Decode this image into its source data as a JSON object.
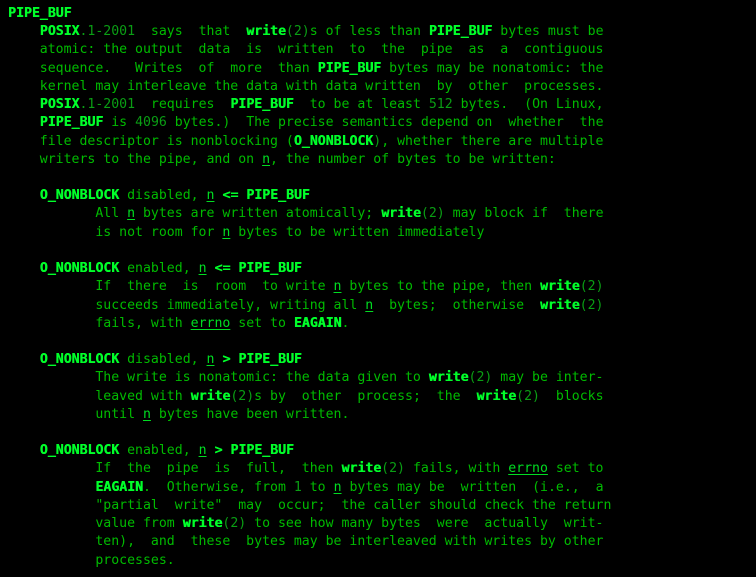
{
  "terminal": {
    "app": "man-page-viewer",
    "foreground_color": "#00bb00",
    "bold_color": "#00ff2a",
    "background_color": "#000000",
    "section_heading": "PIPE_BUF",
    "lines": [
      "PIPE_BUF",
      "    POSIX.1-2001  says  that  write(2)s of less than PIPE_BUF bytes must be",
      "    atomic: the output  data  is  written  to  the  pipe  as  a  contiguous",
      "    sequence.   Writes  of  more  than PIPE_BUF bytes may be nonatomic: the",
      "    kernel may interleave the data with data written  by  other  processes.",
      "    POSIX.1-2001  requires  PIPE_BUF  to be at least 512 bytes.  (On Linux,",
      "    PIPE_BUF is 4096 bytes.)  The precise semantics depend on  whether  the",
      "    file descriptor is nonblocking (O_NONBLOCK), whether there are multiple",
      "    writers to the pipe, and on n, the number of bytes to be written:",
      "",
      "    O_NONBLOCK disabled, n <= PIPE_BUF",
      "           All n bytes are written atomically; write(2) may block if  there",
      "           is not room for n bytes to be written immediately",
      "",
      "    O_NONBLOCK enabled, n <= PIPE_BUF",
      "           If  there  is  room  to write n bytes to the pipe, then write(2)",
      "           succeeds immediately, writing all n  bytes;  otherwise  write(2)",
      "           fails, with errno set to EAGAIN.",
      "",
      "    O_NONBLOCK disabled, n > PIPE_BUF",
      "           The write is nonatomic: the data given to write(2) may be inter-",
      "           leaved with write(2)s by  other  process;  the  write(2)  blocks",
      "           until n bytes have been written.",
      "",
      "    O_NONBLOCK enabled, n > PIPE_BUF",
      "           If  the  pipe  is  full,  then write(2) fails, with errno set to",
      "           EAGAIN.  Otherwise, from 1 to n bytes may be  written  (i.e.,  a",
      "           \"partial  write\"  may  occur;  the caller should check the return",
      "           value from write(2) to see how many bytes  were  actually  writ-",
      "           ten),  and  these  bytes may be interleaved with writes by other",
      "           processes."
    ],
    "emphasis": {
      "bold_terms": [
        "PIPE_BUF",
        "POSIX",
        "O_NONBLOCK",
        "write",
        "EAGAIN"
      ],
      "italic_terms": [
        "n",
        "errno"
      ]
    }
  }
}
